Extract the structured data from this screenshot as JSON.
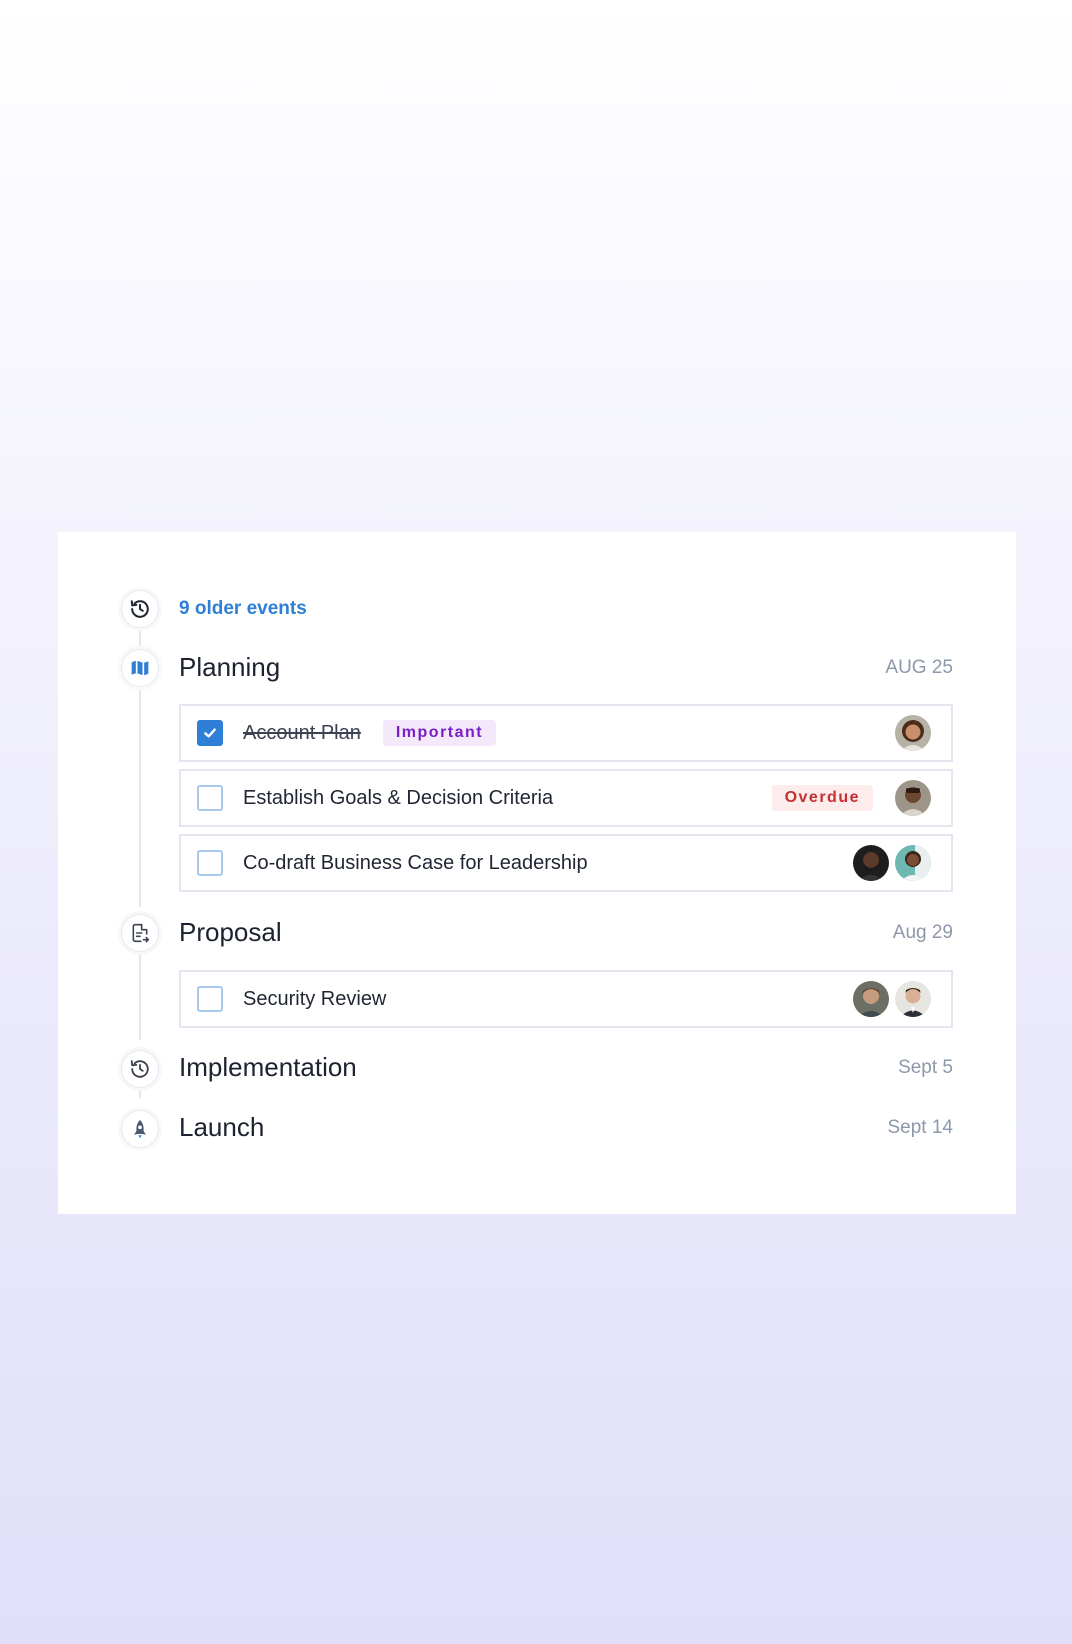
{
  "timeline": {
    "older_events": "9 older events",
    "phases": [
      {
        "title": "Planning",
        "date": "AUG 25",
        "tasks": [
          {
            "label": "Account Plan",
            "checked": true,
            "badge": "Important"
          },
          {
            "label": "Establish Goals & Decision Criteria",
            "checked": false,
            "badge": "Overdue"
          },
          {
            "label": "Co-draft Business Case for Leadership",
            "checked": false
          }
        ]
      },
      {
        "title": "Proposal",
        "date": "Aug 29",
        "tasks": [
          {
            "label": "Security Review",
            "checked": false
          }
        ]
      },
      {
        "title": "Implementation",
        "date": "Sept 5"
      },
      {
        "title": "Launch",
        "date": "Sept 14"
      }
    ]
  },
  "colors": {
    "accent": "#2f7fd6",
    "important_text": "#7a1fc7",
    "important_bg": "#f3e9fb",
    "overdue_text": "#c62f2f",
    "overdue_bg": "#fdecec",
    "muted_date": "#8d98ab"
  },
  "icons": {
    "older_events": "history-icon",
    "planning": "map-icon",
    "proposal": "document-share-icon",
    "implementation": "history-icon",
    "launch": "rocket-icon"
  }
}
